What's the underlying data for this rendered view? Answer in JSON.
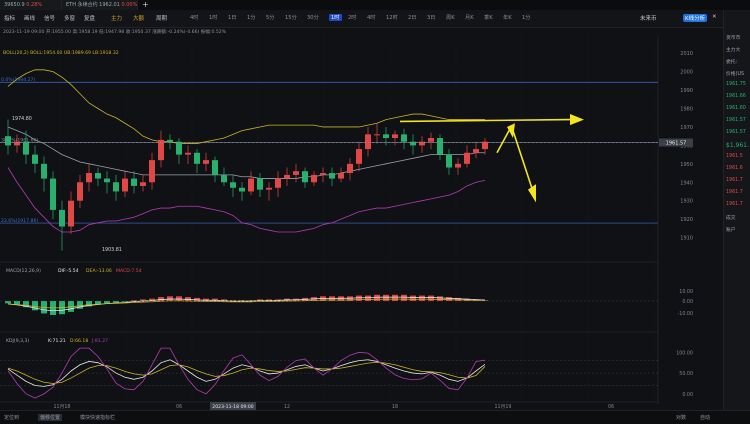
{
  "tabs": [
    {
      "price": "39650.9",
      "change": "0.28%"
    },
    {
      "symbol": "ETH 永续合约",
      "price": "1962.01",
      "change": "0.00%"
    }
  ],
  "toolbar": {
    "items": [
      "指标",
      "画线",
      "信号",
      "多窗",
      "复盘",
      "主力",
      "大额",
      "周期"
    ],
    "periods": [
      "4时",
      "1时",
      "1日",
      "1分",
      "5分",
      "15分",
      "30分",
      "1时",
      "2时",
      "4时",
      "12时",
      "2日",
      "3日",
      "周K",
      "月K",
      "季K",
      "年K",
      "1分"
    ],
    "active_period_index": 7,
    "market_label": "未来币",
    "kline_button": "K线分析"
  },
  "infobar": {
    "text": "2023-11-19 09:00  开:1955.00  高:1958.19  低:1947.98  收:1950.37  涨跌额:-0.24%(-4.66)  振幅:0.52%",
    "boll": "BOLL(20,2)  BOLL:1954.00  UB:1989.69  LB:1918.32"
  },
  "chart_data": {
    "type": "candlestick",
    "ylim": [
      1900,
      2015
    ],
    "y_ticks": [
      2010,
      2000,
      1990,
      1980,
      1970,
      1960,
      1950,
      1940,
      1930,
      1920,
      1910
    ],
    "current_price": "1961.57",
    "x_labels": [
      {
        "t": "11月18",
        "i": 6
      },
      {
        "t": "06",
        "i": 19
      },
      {
        "t": "2023-11-18 09:00",
        "i": 25,
        "hl": true
      },
      {
        "t": "12",
        "i": 31
      },
      {
        "t": "18",
        "i": 43
      },
      {
        "t": "11月19",
        "i": 55
      },
      {
        "t": "06",
        "i": 67
      },
      {
        "t": "12",
        "i": 79
      },
      {
        "t": "18",
        "i": 91
      },
      {
        "t": "11月20",
        "i": 103
      },
      {
        "t": "06",
        "i": 115
      }
    ],
    "fib_levels": [
      {
        "label": "0.0%(1994.27)",
        "value": 1994.27,
        "color": "#3b6fd6"
      },
      {
        "label": "38.2%(1961.60)",
        "value": 1961.6,
        "color": "#7f8795"
      },
      {
        "label": "23.6%(1917.86)",
        "value": 1917.86,
        "color": "#3b6fd6"
      }
    ],
    "annotations": [
      {
        "text": "1974.80",
        "value": 1974.8,
        "i": 0
      },
      {
        "text": "1903.81",
        "value": 1903.81,
        "i": 10
      }
    ],
    "candles": [
      [
        1965,
        1960,
        1974,
        1955
      ],
      [
        1960,
        1962,
        1966,
        1956
      ],
      [
        1962,
        1955,
        1968,
        1950
      ],
      [
        1955,
        1950,
        1960,
        1945
      ],
      [
        1950,
        1942,
        1954,
        1935
      ],
      [
        1942,
        1925,
        1946,
        1920
      ],
      [
        1925,
        1916,
        1930,
        1903
      ],
      [
        1916,
        1930,
        1935,
        1912
      ],
      [
        1930,
        1940,
        1944,
        1926
      ],
      [
        1940,
        1945,
        1950,
        1935
      ],
      [
        1945,
        1942,
        1948,
        1938
      ],
      [
        1942,
        1940,
        1946,
        1934
      ],
      [
        1940,
        1935,
        1944,
        1930
      ],
      [
        1935,
        1942,
        1946,
        1932
      ],
      [
        1942,
        1938,
        1946,
        1934
      ],
      [
        1938,
        1940,
        1944,
        1935
      ],
      [
        1940,
        1952,
        1956,
        1936
      ],
      [
        1952,
        1963,
        1968,
        1948
      ],
      [
        1963,
        1962,
        1966,
        1958
      ],
      [
        1962,
        1955,
        1964,
        1950
      ],
      [
        1955,
        1956,
        1960,
        1950
      ],
      [
        1956,
        1950,
        1958,
        1945
      ],
      [
        1950,
        1952,
        1956,
        1946
      ],
      [
        1952,
        1944,
        1954,
        1940
      ],
      [
        1944,
        1940,
        1948,
        1938
      ],
      [
        1940,
        1937,
        1944,
        1932
      ],
      [
        1937,
        1935,
        1940,
        1930
      ],
      [
        1935,
        1942,
        1946,
        1933
      ],
      [
        1942,
        1936,
        1945,
        1932
      ],
      [
        1936,
        1937,
        1940,
        1930
      ],
      [
        1937,
        1942,
        1946,
        1932
      ],
      [
        1942,
        1944,
        1948,
        1938
      ],
      [
        1944,
        1946,
        1950,
        1940
      ],
      [
        1946,
        1940,
        1948,
        1937
      ],
      [
        1940,
        1944,
        1946,
        1938
      ],
      [
        1944,
        1945,
        1948,
        1940
      ],
      [
        1945,
        1942,
        1948,
        1938
      ],
      [
        1942,
        1945,
        1948,
        1940
      ],
      [
        1945,
        1950,
        1953,
        1941
      ],
      [
        1950,
        1958,
        1962,
        1946
      ],
      [
        1958,
        1966,
        1970,
        1954
      ],
      [
        1966,
        1966,
        1972,
        1961
      ],
      [
        1966,
        1964,
        1970,
        1960
      ],
      [
        1964,
        1966,
        1968,
        1960
      ],
      [
        1966,
        1962,
        1969,
        1958
      ],
      [
        1962,
        1960,
        1966,
        1955
      ],
      [
        1960,
        1962,
        1965,
        1956
      ],
      [
        1962,
        1964,
        1967,
        1958
      ],
      [
        1964,
        1955,
        1966,
        1952
      ],
      [
        1955,
        1948,
        1958,
        1944
      ],
      [
        1948,
        1950,
        1953,
        1944
      ],
      [
        1950,
        1956,
        1960,
        1948
      ],
      [
        1956,
        1958,
        1962,
        1953
      ],
      [
        1958,
        1962,
        1964,
        1955
      ]
    ],
    "boll_upper": [
      1992,
      1996,
      1999,
      2001,
      2001,
      2000,
      1997,
      1993,
      1988,
      1983,
      1980,
      1977,
      1975,
      1972,
      1969,
      1965,
      1963,
      1962,
      1962,
      1961,
      1961,
      1961,
      1962,
      1963,
      1964,
      1966,
      1968,
      1969,
      1970,
      1971,
      1971,
      1971,
      1971,
      1971,
      1971,
      1970,
      1970,
      1970,
      1970,
      1970,
      1971,
      1972,
      1974,
      1975,
      1976,
      1977,
      1977,
      1976,
      1975,
      1974,
      1974,
      1974,
      1974,
      1974
    ],
    "boll_mid": [
      1970,
      1968,
      1966,
      1963,
      1961,
      1958,
      1955,
      1953,
      1951,
      1950,
      1949,
      1948,
      1947,
      1946,
      1945,
      1944,
      1944,
      1944,
      1944,
      1944,
      1944,
      1944,
      1944,
      1944,
      1944,
      1944,
      1943,
      1943,
      1942,
      1942,
      1942,
      1942,
      1942,
      1943,
      1943,
      1944,
      1944,
      1945,
      1946,
      1947,
      1948,
      1949,
      1950,
      1951,
      1952,
      1953,
      1954,
      1955,
      1955,
      1955,
      1955,
      1955,
      1956,
      1956
    ],
    "boll_lower": [
      1948,
      1940,
      1933,
      1926,
      1921,
      1916,
      1913,
      1913,
      1914,
      1917,
      1918,
      1919,
      1919,
      1920,
      1921,
      1923,
      1925,
      1926,
      1926,
      1927,
      1927,
      1927,
      1926,
      1925,
      1924,
      1922,
      1918,
      1917,
      1915,
      1914,
      1913,
      1913,
      1913,
      1914,
      1915,
      1917,
      1918,
      1920,
      1922,
      1924,
      1925,
      1926,
      1926,
      1927,
      1928,
      1929,
      1930,
      1931,
      1932,
      1933,
      1935,
      1938,
      1940,
      1941
    ],
    "macd": {
      "label": "MACD(12,26,9)",
      "dif": "DIF:-5.54",
      "dea": "DEA:-13.06",
      "macd": "MACD:7.54",
      "bars": [
        -3,
        -5,
        -8,
        -12,
        -16,
        -18,
        -17,
        -14,
        -10,
        -7,
        -5,
        -3,
        -2,
        -1,
        1,
        2,
        3,
        5,
        6,
        6,
        5,
        4,
        3,
        3,
        2,
        1,
        1,
        1,
        2,
        2,
        2,
        3,
        3,
        4,
        5,
        6,
        6,
        6,
        6,
        7,
        7,
        8,
        8,
        8,
        8,
        7,
        7,
        7,
        6,
        5,
        4,
        3,
        2,
        1
      ]
    },
    "kdj": {
      "label": "KDJ(9,3,3)",
      "k": "K:71.21",
      "d": "D:66.18",
      "j": "J:81.27",
      "k_vals": [
        60,
        45,
        30,
        20,
        18,
        22,
        35,
        55,
        70,
        78,
        75,
        65,
        50,
        40,
        35,
        40,
        55,
        75,
        82,
        70,
        55,
        40,
        30,
        35,
        48,
        62,
        70,
        65,
        55,
        48,
        50,
        58,
        66,
        70,
        62,
        55,
        60,
        68,
        75,
        80,
        82,
        78,
        70,
        62,
        55,
        50,
        48,
        52,
        45,
        35,
        30,
        38,
        55,
        71
      ],
      "d_vals": [
        62,
        55,
        45,
        35,
        28,
        25,
        28,
        38,
        50,
        62,
        68,
        68,
        62,
        54,
        48,
        45,
        48,
        58,
        68,
        70,
        65,
        56,
        48,
        42,
        44,
        50,
        58,
        62,
        60,
        56,
        54,
        55,
        59,
        63,
        62,
        60,
        60,
        62,
        66,
        70,
        74,
        76,
        74,
        70,
        64,
        58,
        54,
        53,
        51,
        46,
        40,
        38,
        44,
        66
      ],
      "j_vals": [
        56,
        25,
        0,
        -10,
        0,
        16,
        50,
        90,
        110,
        110,
        90,
        60,
        26,
        12,
        10,
        30,
        70,
        110,
        110,
        70,
        35,
        10,
        0,
        22,
        56,
        86,
        94,
        70,
        45,
        32,
        42,
        64,
        80,
        84,
        62,
        45,
        60,
        80,
        93,
        100,
        98,
        82,
        62,
        46,
        37,
        34,
        36,
        50,
        33,
        13,
        10,
        38,
        78,
        81
      ]
    }
  },
  "right_panel": {
    "items": [
      "货币市",
      "主力大",
      "委托:",
      "价格(US",
      "1961.75",
      "1961.66",
      "1961.60",
      "1961.57",
      "1961.57",
      "$1,961.",
      "1961.5",
      "1961.6",
      "1961.7",
      "1961.7",
      "1961.7",
      "成交",
      "账户"
    ],
    "bid_color": "#27b06e",
    "ask_color": "#e04848"
  },
  "bottombar": {
    "left": "定位到",
    "btn": "偏移位置",
    "hint": "模块快速指标栏",
    "right_a": "对数",
    "right_b": "自动"
  },
  "colors": {
    "up": "#e04848",
    "down": "#27b06e",
    "boll_upper": "#c9b52a",
    "boll_mid": "#9aa2ae",
    "boll_lower": "#b23bb3",
    "arrow": "#f2e51f",
    "dif": "#e8e8e8",
    "dea": "#c9b52a",
    "k": "#e8e8e8",
    "d": "#c9b52a",
    "j": "#b23bb3"
  }
}
